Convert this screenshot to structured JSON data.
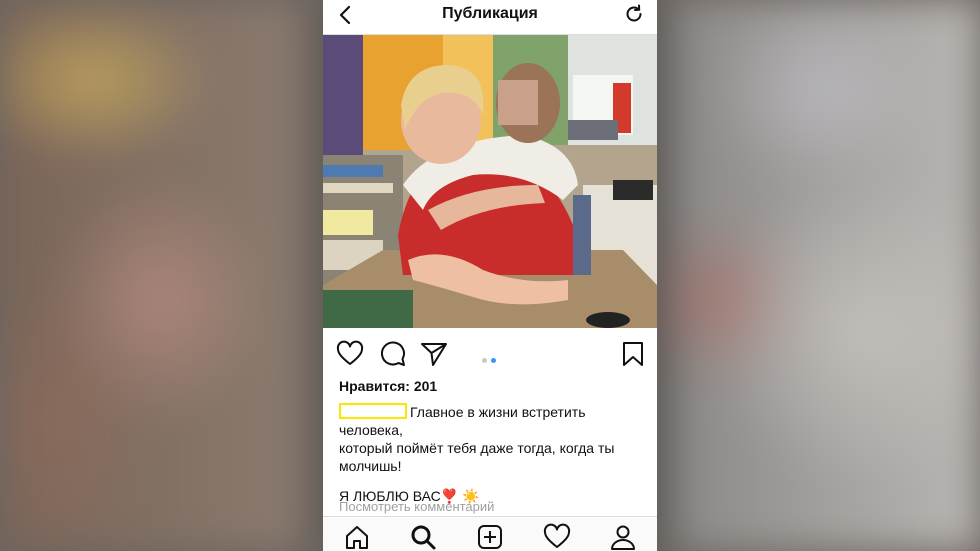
{
  "header": {
    "title": "Публикация"
  },
  "post": {
    "likes_text": "Нравится: 201",
    "caption_line1": "Главное в жизни встретить человека,",
    "caption_line2": "который поймёт тебя даже тогда, когда ты молчишь!",
    "caption_love": "Я ЛЮБЛЮ ВАС",
    "caption_emoji": "❣️ ☀️",
    "view_comments": "Посмотреть комментарий",
    "carousel": {
      "count": 2,
      "active_index": 2
    }
  },
  "icons": {
    "back": "chevron-left-icon",
    "refresh": "refresh-icon",
    "like": "heart-icon",
    "comment": "comment-icon",
    "share": "paper-plane-icon",
    "save": "bookmark-icon",
    "home": "home-icon",
    "search": "search-icon",
    "new_post": "add-post-icon",
    "activity": "heart-icon",
    "profile": "profile-icon"
  },
  "colors": {
    "accent_blue": "#3897f0",
    "username_highlight": "#ffe600",
    "muted_text": "#a0a0a0"
  }
}
